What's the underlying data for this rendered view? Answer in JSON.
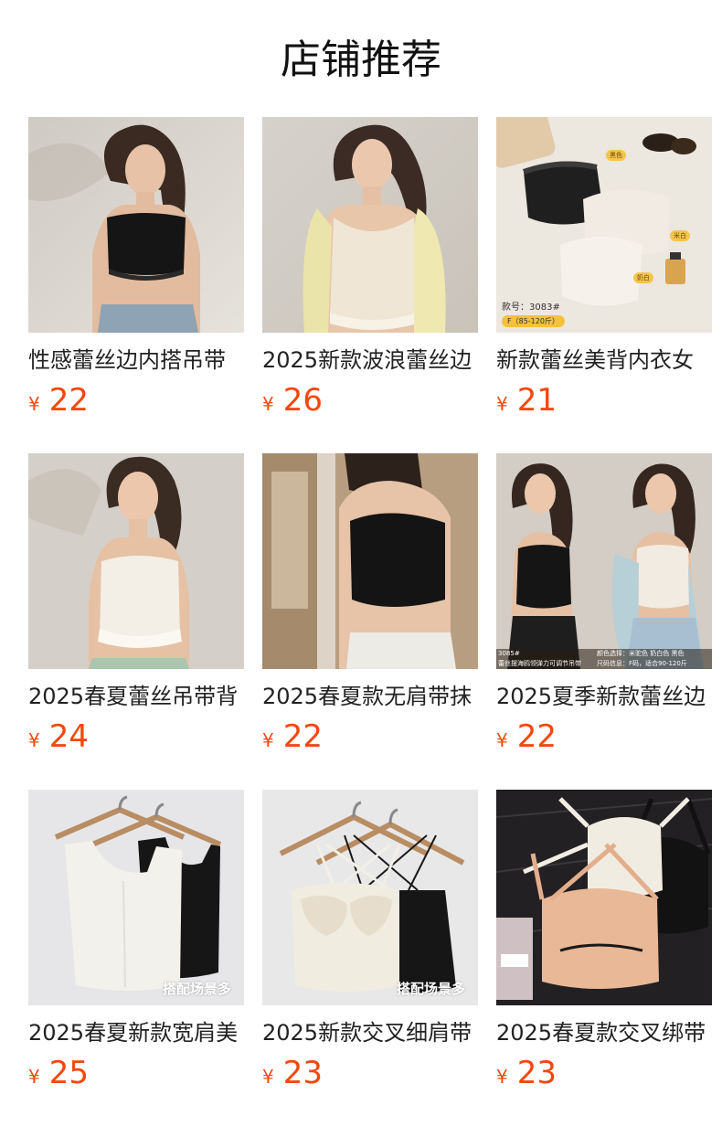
{
  "page": {
    "title": "店铺推荐"
  },
  "products": [
    {
      "name": "性感蕾丝边内搭吊带",
      "currency": "¥",
      "price": "22",
      "image": "model-black-lace-camisole"
    },
    {
      "name": "2025新款波浪蕾丝边",
      "currency": "¥",
      "price": "26",
      "image": "model-cream-camisole-cardigan"
    },
    {
      "name": "新款蕾丝美背内衣女",
      "currency": "¥",
      "price": "21",
      "image": "flatlay-lace-bralettes",
      "overlay": {
        "style_no": "款号：3083#",
        "size": "F（85-120斤）",
        "colors": [
          "黑色",
          "米白",
          "奶白"
        ]
      }
    },
    {
      "name": "2025春夏蕾丝吊带背",
      "currency": "¥",
      "price": "24",
      "image": "model-white-lace-camisole"
    },
    {
      "name": "2025春夏款无肩带抹",
      "currency": "¥",
      "price": "22",
      "image": "model-black-tube-top"
    },
    {
      "name": "2025夏季新款蕾丝边",
      "currency": "¥",
      "price": "22",
      "image": "two-models-camisoles",
      "overlay": {
        "left": "3085#",
        "left2": "蕾丝摆海鸥领弹力可调节吊带",
        "right": "颜色选择：米驼色  奶白色  黑色",
        "right2": "尺码信息：F码，适合90-120斤"
      }
    },
    {
      "name": "2025春夏新款宽肩美",
      "currency": "¥",
      "price": "25",
      "image": "hanger-wide-strap-tanks",
      "overlay": {
        "tag": "搭配场景多"
      }
    },
    {
      "name": "2025新款交叉细肩带",
      "currency": "¥",
      "price": "23",
      "image": "hanger-cross-strap-camis",
      "overlay": {
        "tag": "搭配场景多"
      }
    },
    {
      "name": "2025春夏款交叉绑带",
      "currency": "¥",
      "price": "23",
      "image": "flatlay-cross-strap-bras"
    }
  ]
}
